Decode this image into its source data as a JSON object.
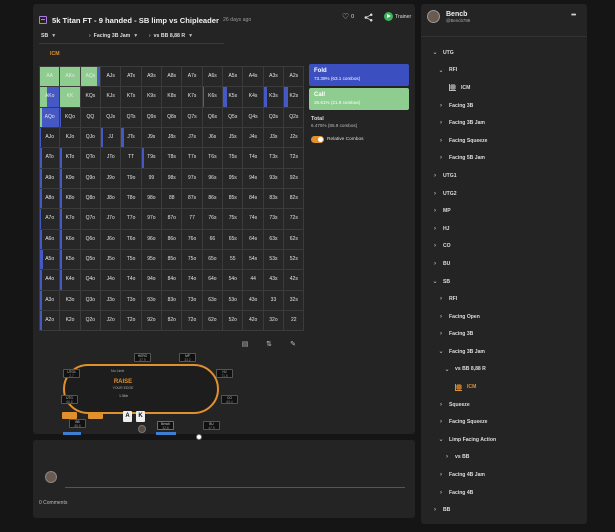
{
  "header": {
    "title": "5k Titan FT - 9 handed - SB limp vs Chipleader",
    "ago": "26 days ago",
    "likes": "0",
    "trainer_label": "Trainer"
  },
  "selectors": {
    "position": "SB",
    "action": "Facing 3B Jam",
    "vs": "vs BB 8,88 R"
  },
  "tabs": {
    "icm": "ICM"
  },
  "grid": {
    "hands": [
      [
        "AA",
        "AKs",
        "AQs",
        "AJs",
        "ATs",
        "A9s",
        "A8s",
        "A7s",
        "A6s",
        "A5s",
        "A4s",
        "A3s",
        "A2s"
      ],
      [
        "AKo",
        "KK",
        "KQs",
        "KJs",
        "KTs",
        "K9s",
        "K8s",
        "K7s",
        "K6s",
        "K5s",
        "K4s",
        "K3s",
        "K2s"
      ],
      [
        "AQo",
        "KQo",
        "QQ",
        "QJs",
        "QTs",
        "Q9s",
        "Q8s",
        "Q7s",
        "Q6s",
        "Q5s",
        "Q4s",
        "Q3s",
        "Q2s"
      ],
      [
        "AJo",
        "KJo",
        "QJo",
        "JJ",
        "JTs",
        "J9s",
        "J8s",
        "J7s",
        "J6s",
        "J5s",
        "J4s",
        "J3s",
        "J2s"
      ],
      [
        "ATo",
        "KTo",
        "QTo",
        "JTo",
        "TT",
        "T9s",
        "T8s",
        "T7s",
        "T6s",
        "T5s",
        "T4s",
        "T3s",
        "T2s"
      ],
      [
        "A9o",
        "K9o",
        "Q9o",
        "J9o",
        "T9o",
        "99",
        "98s",
        "97s",
        "96s",
        "95s",
        "94s",
        "93s",
        "92s"
      ],
      [
        "A8o",
        "K8o",
        "Q8o",
        "J8o",
        "T8o",
        "98o",
        "88",
        "87s",
        "86s",
        "85s",
        "84s",
        "83s",
        "82s"
      ],
      [
        "A7o",
        "K7o",
        "Q7o",
        "J7o",
        "T7o",
        "97o",
        "87o",
        "77",
        "76s",
        "75s",
        "74s",
        "73s",
        "72s"
      ],
      [
        "A6o",
        "K6o",
        "Q6o",
        "J6o",
        "T6o",
        "96o",
        "86o",
        "76o",
        "66",
        "65s",
        "64s",
        "63s",
        "62s"
      ],
      [
        "A5o",
        "K5o",
        "Q5o",
        "J5o",
        "T5o",
        "95o",
        "85o",
        "75o",
        "65o",
        "55",
        "54s",
        "53s",
        "52s"
      ],
      [
        "A4o",
        "K4o",
        "Q4o",
        "J4o",
        "T4o",
        "94o",
        "84o",
        "74o",
        "64o",
        "54o",
        "44",
        "43s",
        "42s"
      ],
      [
        "A3o",
        "K3o",
        "Q3o",
        "J3o",
        "T3o",
        "93o",
        "83o",
        "73o",
        "63o",
        "53o",
        "43o",
        "33",
        "32s"
      ],
      [
        "A2o",
        "K2o",
        "Q2o",
        "J2o",
        "T2o",
        "92o",
        "82o",
        "72o",
        "62o",
        "52o",
        "42o",
        "32o",
        "22"
      ]
    ],
    "call_freq": [
      [
        1,
        1,
        0.85,
        0,
        0,
        0,
        0,
        0,
        0,
        0,
        0,
        0,
        0
      ],
      [
        0.35,
        1,
        0,
        0,
        0,
        0,
        0,
        0,
        0,
        0,
        0,
        0,
        0
      ],
      [
        0.1,
        0,
        0,
        0,
        0,
        0,
        0,
        0,
        0,
        0,
        0,
        0,
        0
      ],
      [
        0,
        0,
        0,
        0,
        0,
        0,
        0,
        0,
        0,
        0,
        0,
        0,
        0
      ],
      [
        0,
        0,
        0,
        0,
        0,
        0,
        0,
        0,
        0,
        0,
        0,
        0,
        0
      ],
      [
        0,
        0,
        0,
        0,
        0,
        0,
        0,
        0,
        0,
        0,
        0,
        0,
        0
      ],
      [
        0,
        0,
        0,
        0,
        0,
        0,
        0,
        0,
        0,
        0,
        0,
        0,
        0
      ],
      [
        0,
        0,
        0,
        0,
        0,
        0,
        0,
        0,
        0,
        0,
        0,
        0,
        0
      ],
      [
        0,
        0,
        0,
        0,
        0,
        0,
        0,
        0,
        0,
        0,
        0,
        0,
        0
      ],
      [
        0,
        0,
        0,
        0,
        0,
        0,
        0,
        0,
        0,
        0,
        0,
        0,
        0
      ],
      [
        0,
        0,
        0,
        0,
        0,
        0,
        0,
        0,
        0,
        0,
        0,
        0,
        0
      ],
      [
        0,
        0,
        0,
        0,
        0,
        0,
        0,
        0,
        0,
        0,
        0,
        0,
        0
      ],
      [
        0,
        0,
        0,
        0,
        0,
        0,
        0,
        0,
        0,
        0,
        0,
        0,
        0
      ]
    ],
    "fold_freq": [
      [
        0,
        0,
        0.15,
        0,
        0,
        0,
        0,
        0,
        0,
        0,
        0,
        0,
        0
      ],
      [
        0.65,
        0,
        0,
        0,
        0,
        0,
        0,
        0,
        0.2,
        0.6,
        0,
        0.5,
        0.6
      ],
      [
        0.9,
        0.15,
        0,
        0,
        0,
        0,
        0,
        0,
        0,
        0,
        0,
        0,
        0
      ],
      [
        0.2,
        0,
        0,
        0.4,
        0.5,
        0,
        0,
        0,
        0,
        0,
        0,
        0,
        0
      ],
      [
        0.4,
        0.35,
        0,
        0,
        0,
        0.35,
        0,
        0,
        0,
        0,
        0,
        0,
        0
      ],
      [
        0.3,
        0.3,
        0,
        0,
        0,
        0,
        0,
        0,
        0,
        0,
        0,
        0,
        0
      ],
      [
        0.3,
        0.3,
        0,
        0,
        0,
        0,
        0,
        0,
        0,
        0,
        0,
        0,
        0
      ],
      [
        0.25,
        0.2,
        0,
        0,
        0,
        0,
        0,
        0,
        0,
        0,
        0,
        0,
        0
      ],
      [
        0.4,
        0.25,
        0,
        0,
        0,
        0,
        0,
        0,
        0,
        0,
        0,
        0,
        0
      ],
      [
        0.45,
        0.2,
        0,
        0,
        0,
        0,
        0,
        0,
        0,
        0,
        0,
        0,
        0
      ],
      [
        0.4,
        0.2,
        0,
        0,
        0,
        0,
        0,
        0,
        0,
        0,
        0,
        0,
        0
      ],
      [
        0.35,
        0,
        0,
        0,
        0,
        0,
        0,
        0,
        0,
        0,
        0,
        0,
        0
      ],
      [
        0.3,
        0,
        0,
        0,
        0,
        0,
        0,
        0,
        0,
        0,
        0,
        0,
        0
      ]
    ]
  },
  "legend": {
    "fold_label": "Fold",
    "fold_value": "73.39% (63.1 combos)",
    "call_label": "Call",
    "call_value": "26.61% (21.9 combos)",
    "total_label": "Total",
    "total_value": "6.475% (85.9 combos)",
    "relative_label": "Relative Combos"
  },
  "colors": {
    "fold": "#3c4fc0",
    "call": "#8fcc8f",
    "accent": "#e2902d"
  },
  "table": {
    "logo": "RAISE",
    "logo_sub": "YOUR EDGE",
    "pot": "1.5bb",
    "felt_text": "No Limit",
    "hero_cards": [
      "A",
      "K"
    ],
    "seats": [
      {
        "name": "UTG1",
        "stack": "2.7"
      },
      {
        "name": "HERO",
        "stack": "37.9"
      },
      {
        "name": "MP",
        "stack": "33.2"
      },
      {
        "name": "HJ",
        "stack": "71.5"
      },
      {
        "name": "UTG",
        "stack": "66.8"
      },
      {
        "name": "CO",
        "stack": "63.4"
      },
      {
        "name": "BB",
        "stack": "88.8"
      },
      {
        "name": "Bencb",
        "stack": "32.8"
      },
      {
        "name": "BU",
        "stack": "47.9"
      }
    ]
  },
  "comments": {
    "count": "0 Comments"
  },
  "user": {
    "name": "Bencb",
    "handle": "@Bencb789"
  },
  "tree": [
    {
      "label": "UTG",
      "depth": 0,
      "state": "open"
    },
    {
      "label": "RFI",
      "depth": 1,
      "state": "open"
    },
    {
      "label": "ICM",
      "depth": 2,
      "state": "leaf"
    },
    {
      "label": "Facing 3B",
      "depth": 1,
      "state": "closed"
    },
    {
      "label": "Facing 3B Jam",
      "depth": 1,
      "state": "closed"
    },
    {
      "label": "Facing Squeeze",
      "depth": 1,
      "state": "closed"
    },
    {
      "label": "Facing 5B Jam",
      "depth": 1,
      "state": "closed"
    },
    {
      "label": "UTG1",
      "depth": 0,
      "state": "closed"
    },
    {
      "label": "UTG2",
      "depth": 0,
      "state": "closed"
    },
    {
      "label": "MP",
      "depth": 0,
      "state": "closed"
    },
    {
      "label": "HJ",
      "depth": 0,
      "state": "closed"
    },
    {
      "label": "CO",
      "depth": 0,
      "state": "closed"
    },
    {
      "label": "BU",
      "depth": 0,
      "state": "closed"
    },
    {
      "label": "SB",
      "depth": 0,
      "state": "open"
    },
    {
      "label": "RFI",
      "depth": 1,
      "state": "closed"
    },
    {
      "label": "Facing Open",
      "depth": 1,
      "state": "closed"
    },
    {
      "label": "Facing 3B",
      "depth": 1,
      "state": "closed"
    },
    {
      "label": "Facing 3B Jam",
      "depth": 1,
      "state": "open"
    },
    {
      "label": "vs BB 8,88 R",
      "depth": 2,
      "state": "open"
    },
    {
      "label": "ICM",
      "depth": 3,
      "state": "active"
    },
    {
      "label": "Squeeze",
      "depth": 1,
      "state": "closed"
    },
    {
      "label": "Facing Squeeze",
      "depth": 1,
      "state": "closed"
    },
    {
      "label": "Limp Facing Action",
      "depth": 1,
      "state": "open"
    },
    {
      "label": "vs BB",
      "depth": 2,
      "state": "closed"
    },
    {
      "label": "Facing 4B Jam",
      "depth": 1,
      "state": "closed"
    },
    {
      "label": "Facing 4B",
      "depth": 1,
      "state": "closed"
    },
    {
      "label": "BB",
      "depth": 0,
      "state": "closed"
    }
  ]
}
